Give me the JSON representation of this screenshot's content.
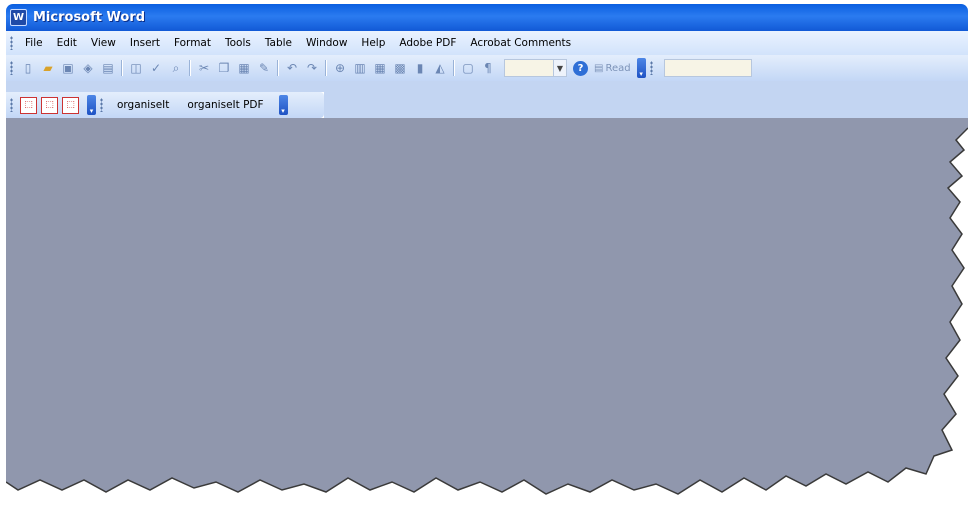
{
  "window": {
    "title": "Microsoft Word",
    "app_icon_letter": "W"
  },
  "menu": {
    "items": [
      "File",
      "Edit",
      "View",
      "Insert",
      "Format",
      "Tools",
      "Table",
      "Window",
      "Help",
      "Adobe PDF",
      "Acrobat Comments"
    ]
  },
  "toolbar": {
    "read_label": "Read",
    "help_glyph": "?"
  },
  "pdf_toolbar": {
    "items": [
      "organiseIt",
      "organiseIt PDF"
    ]
  },
  "colors": {
    "titlebar": "#1159d6",
    "workspace": "#9097ad",
    "toolbar_bg": "#c3d7f6"
  }
}
